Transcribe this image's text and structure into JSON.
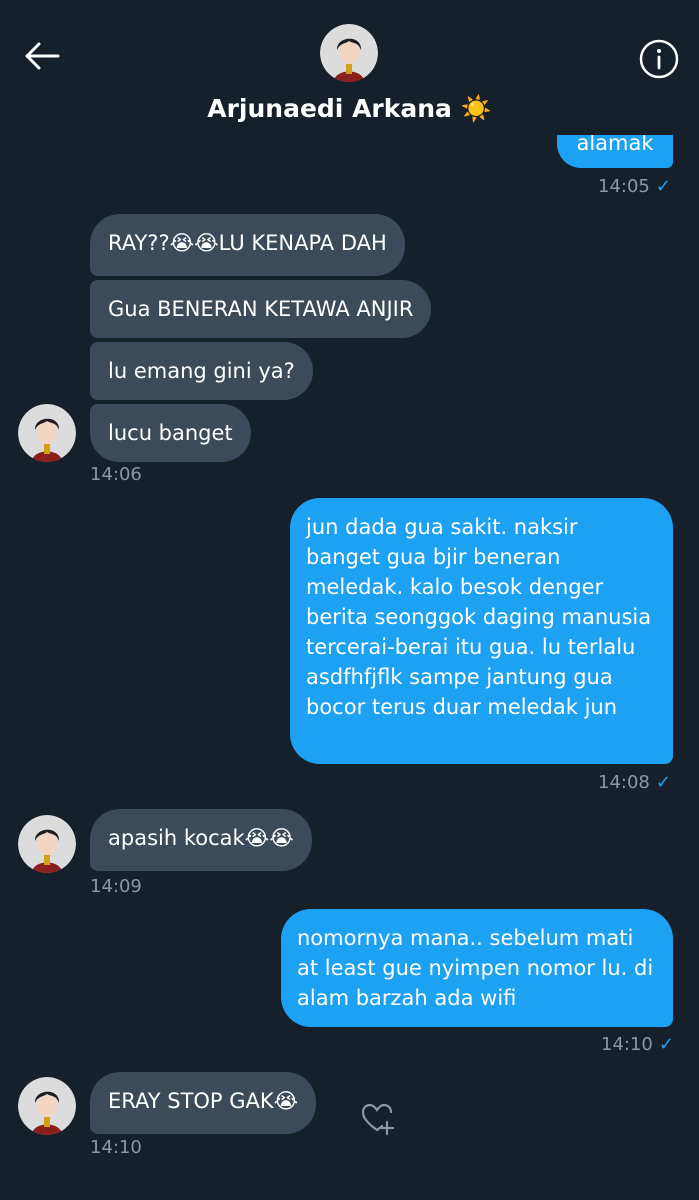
{
  "header": {
    "contact_name": "Arjunaedi Arkana ☀️"
  },
  "messages": [
    {
      "from": "me",
      "text": "alamak"
    },
    {
      "time": "14:05",
      "read": true
    },
    {
      "from": "them",
      "text": "RAY??😭😭LU KENAPA DAH"
    },
    {
      "from": "them",
      "text": "Gua BENERAN KETAWA ANJIR"
    },
    {
      "from": "them",
      "text": "lu emang gini ya?"
    },
    {
      "from": "them",
      "text": "lucu banget"
    },
    {
      "time": "14:06"
    },
    {
      "from": "me",
      "text": "jun dada gua sakit. naksir banget gua bjir beneran meledak. kalo besok denger berita seonggok daging manusia tercerai-berai itu gua. lu terlalu asdfhfjflk sampe jantung gua bocor terus duar meledak jun"
    },
    {
      "time": "14:08",
      "read": true
    },
    {
      "from": "them",
      "text": "apasih kocak😭😭"
    },
    {
      "time": "14:09"
    },
    {
      "from": "me",
      "text": "nomornya mana.. sebelum mati at least gue nyimpen nomor lu. di alam barzah ada wifi"
    },
    {
      "time": "14:10",
      "read": true
    },
    {
      "from": "them",
      "text": "ERAY STOP GAK😭"
    },
    {
      "time": "14:10"
    }
  ],
  "colors": {
    "background": "#15202b",
    "received_bubble": "#3d4a59",
    "sent_bubble": "#1da1f2",
    "timestamp": "#8b98a5"
  },
  "icons": [
    "back-arrow-icon",
    "info-icon",
    "heart-add-icon"
  ]
}
